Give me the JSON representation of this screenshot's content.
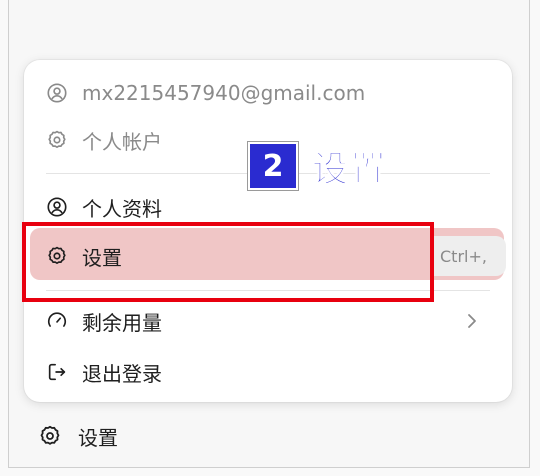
{
  "menu": {
    "email": "mx2215457940@gmail.com",
    "account_label": "个人帐户",
    "profile_label": "个人资料",
    "settings_label": "设置",
    "settings_shortcut": "Ctrl+,",
    "usage_label": "剩余用量",
    "logout_label": "退出登录"
  },
  "annotation": {
    "step_number": "2",
    "step_text": "设置",
    "highlight_color": "#e8000f",
    "badge_color": "#2a2bd0"
  },
  "sidebar": {
    "settings_label": "设置"
  },
  "icons": {
    "email": "user-circle-icon",
    "account": "gear-icon",
    "profile": "user-circle-icon",
    "settings": "gear-icon",
    "usage": "gauge-icon",
    "logout": "logout-icon",
    "chevron": "chevron-right-icon"
  }
}
